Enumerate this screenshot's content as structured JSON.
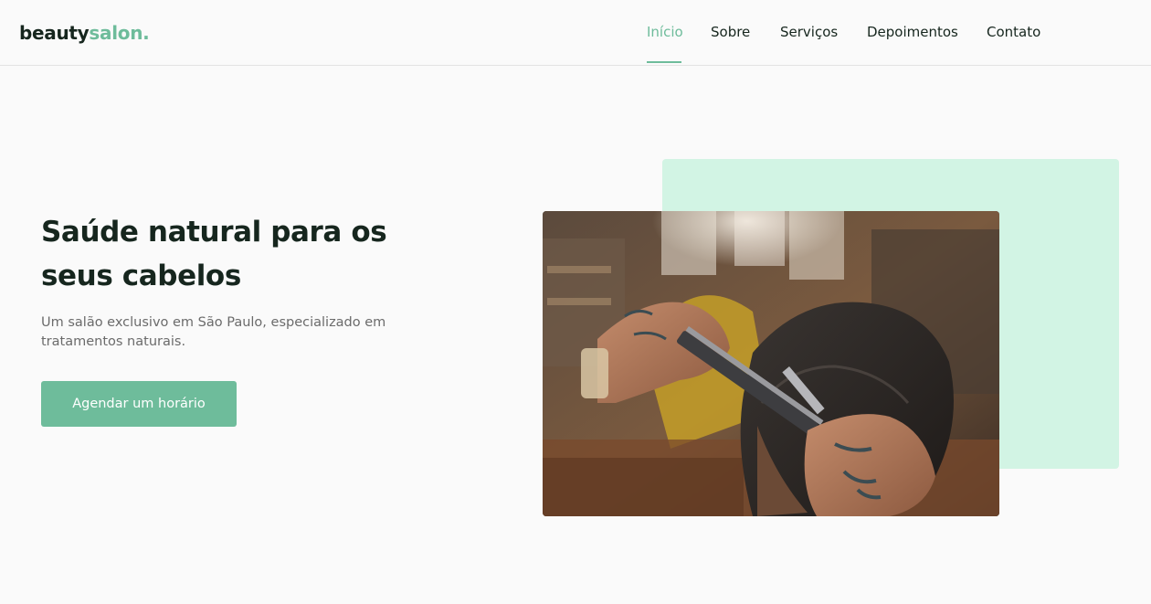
{
  "header": {
    "logo_main": "beauty",
    "logo_accent": "salon."
  },
  "nav": {
    "items": [
      {
        "label": "Início",
        "active": true
      },
      {
        "label": "Sobre",
        "active": false
      },
      {
        "label": "Serviços",
        "active": false
      },
      {
        "label": "Depoimentos",
        "active": false
      },
      {
        "label": "Contato",
        "active": false
      }
    ]
  },
  "hero": {
    "title": "Saúde natural para os seus cabelos",
    "subtitle": "Um salão exclusivo em São Paulo, especializado em tratamentos naturais.",
    "cta_label": "Agendar um horário"
  },
  "colors": {
    "accent": "#6ebc9b",
    "mint": "#d2f4e4",
    "text": "#16261e",
    "muted": "#6b6b6b",
    "background": "#fafafa"
  },
  "icons": {
    "hero_photo": "barber-cutting-hair-photo"
  }
}
